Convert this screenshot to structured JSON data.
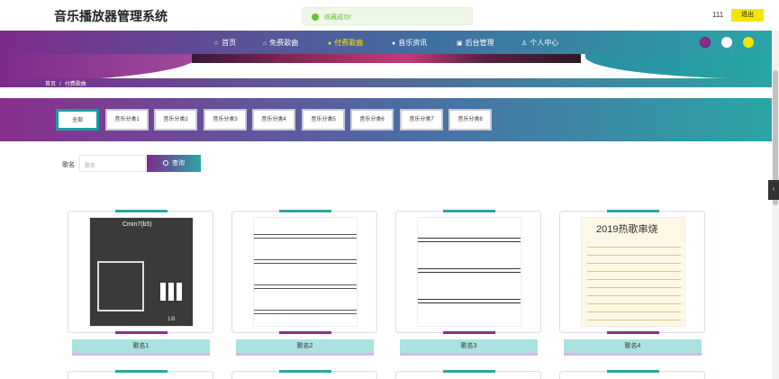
{
  "app": {
    "title": "音乐播放器管理系统"
  },
  "toast": {
    "message": "收藏成功!"
  },
  "user": {
    "name": "111",
    "logout_label": "退出"
  },
  "nav": {
    "items": [
      {
        "label": "首页",
        "icon": "star-icon",
        "glyph": "☆"
      },
      {
        "label": "免费歌曲",
        "icon": "lock-icon",
        "glyph": "⌂"
      },
      {
        "label": "付费歌曲",
        "icon": "dot-icon",
        "glyph": "●"
      },
      {
        "label": "音乐资讯",
        "icon": "dot-icon",
        "glyph": "●"
      },
      {
        "label": "后台管理",
        "icon": "gift-icon",
        "glyph": "▣"
      },
      {
        "label": "个人中心",
        "icon": "user-icon",
        "glyph": "♙"
      }
    ],
    "active_index": 2,
    "theme_colors": [
      "#8a2e8e",
      "#ffffff",
      "#f2e600"
    ]
  },
  "breadcrumb": {
    "home": "首页",
    "separator": "/",
    "current": "付费歌曲"
  },
  "categories": {
    "items": [
      "全部",
      "音乐分类1",
      "音乐分类2",
      "音乐分类3",
      "音乐分类4",
      "音乐分类5",
      "音乐分类6",
      "音乐分类7",
      "音乐分类8"
    ],
    "active_index": 0
  },
  "search": {
    "label": "歌名",
    "placeholder": "歌名",
    "button_label": "查询"
  },
  "songs": [
    {
      "name": "歌名1",
      "chord": "Cmin7(b5)",
      "page": "1/8"
    },
    {
      "name": "歌名2"
    },
    {
      "name": "歌名3"
    },
    {
      "name": "歌名4",
      "sheet_title": "2019热歌串烧"
    }
  ],
  "colors": {
    "accent_purple": "#8a2e8e",
    "accent_teal": "#2aa6a6",
    "active_nav": "#ffe600"
  }
}
